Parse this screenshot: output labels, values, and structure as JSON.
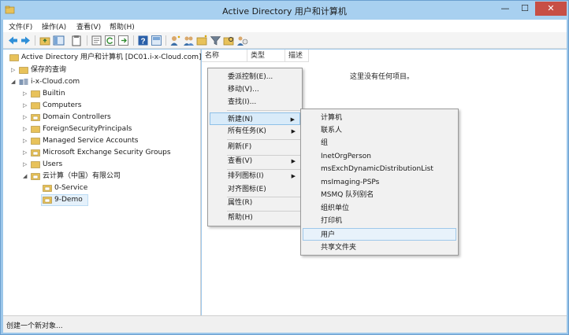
{
  "window": {
    "title": "Active Directory 用户和计算机",
    "minimize_glyph": "—",
    "maximize_glyph": "☐",
    "close_glyph": "✕"
  },
  "menubar": [
    "文件(F)",
    "操作(A)",
    "查看(V)",
    "帮助(H)"
  ],
  "toolbar": {
    "icons": [
      "back-arrow-icon",
      "forward-arrow-icon",
      "up-folder-icon",
      "show-hide-tree-icon",
      "clipboard-icon",
      "properties-icon",
      "refresh-icon",
      "export-list-icon",
      "help-icon",
      "console-tree-icon",
      "new-user-icon",
      "new-group-icon",
      "new-ou-icon",
      "filter-icon",
      "find-icon",
      "add-to-group-icon"
    ]
  },
  "tree": {
    "root": "Active Directory 用户和计算机 [DC01.i-x-Cloud.com]",
    "items": [
      {
        "label": "保存的查询",
        "level": 1,
        "expander": "▷"
      },
      {
        "label": "i-x-Cloud.com",
        "level": 1,
        "expander": "◢"
      },
      {
        "label": "Builtin",
        "level": 2,
        "expander": "▷"
      },
      {
        "label": "Computers",
        "level": 2,
        "expander": "▷"
      },
      {
        "label": "Domain Controllers",
        "level": 2,
        "expander": "▷"
      },
      {
        "label": "ForeignSecurityPrincipals",
        "level": 2,
        "expander": "▷"
      },
      {
        "label": "Managed Service Accounts",
        "level": 2,
        "expander": "▷"
      },
      {
        "label": "Microsoft Exchange Security Groups",
        "level": 2,
        "expander": "▷"
      },
      {
        "label": "Users",
        "level": 2,
        "expander": "▷"
      },
      {
        "label": "云计算（中国）有限公司",
        "level": 2,
        "expander": "◢"
      },
      {
        "label": "0-Service",
        "level": 3,
        "expander": ""
      },
      {
        "label": "9-Demo",
        "level": 3,
        "expander": ""
      }
    ]
  },
  "list": {
    "columns": [
      "名称",
      "类型",
      "描述"
    ],
    "empty_message": "这里没有任何项目。"
  },
  "context_menu": {
    "items": [
      {
        "label": "委派控制(E)...",
        "arrow": ""
      },
      {
        "label": "移动(V)...",
        "arrow": ""
      },
      {
        "label": "查找(I)...",
        "arrow": ""
      },
      {
        "label": "新建(N)",
        "arrow": "▶"
      },
      {
        "label": "所有任务(K)",
        "arrow": "▶"
      },
      {
        "label": "刷新(F)",
        "arrow": ""
      },
      {
        "label": "查看(V)",
        "arrow": "▶"
      },
      {
        "label": "排列图标(I)",
        "arrow": "▶"
      },
      {
        "label": "对齐图标(E)",
        "arrow": ""
      },
      {
        "label": "属性(R)",
        "arrow": ""
      },
      {
        "label": "帮助(H)",
        "arrow": ""
      }
    ]
  },
  "submenu": {
    "items": [
      "计算机",
      "联系人",
      "组",
      "InetOrgPerson",
      "msExchDynamicDistributionList",
      "msImaging-PSPs",
      "MSMQ 队列别名",
      "组织单位",
      "打印机",
      "用户",
      "共享文件夹"
    ]
  },
  "status": {
    "text": "创建一个新对象..."
  },
  "colors": {
    "title_bar": "#a8d0f0",
    "close_button": "#c74f45",
    "selection": "#d9ebf9",
    "folder": "#e8c25a"
  }
}
